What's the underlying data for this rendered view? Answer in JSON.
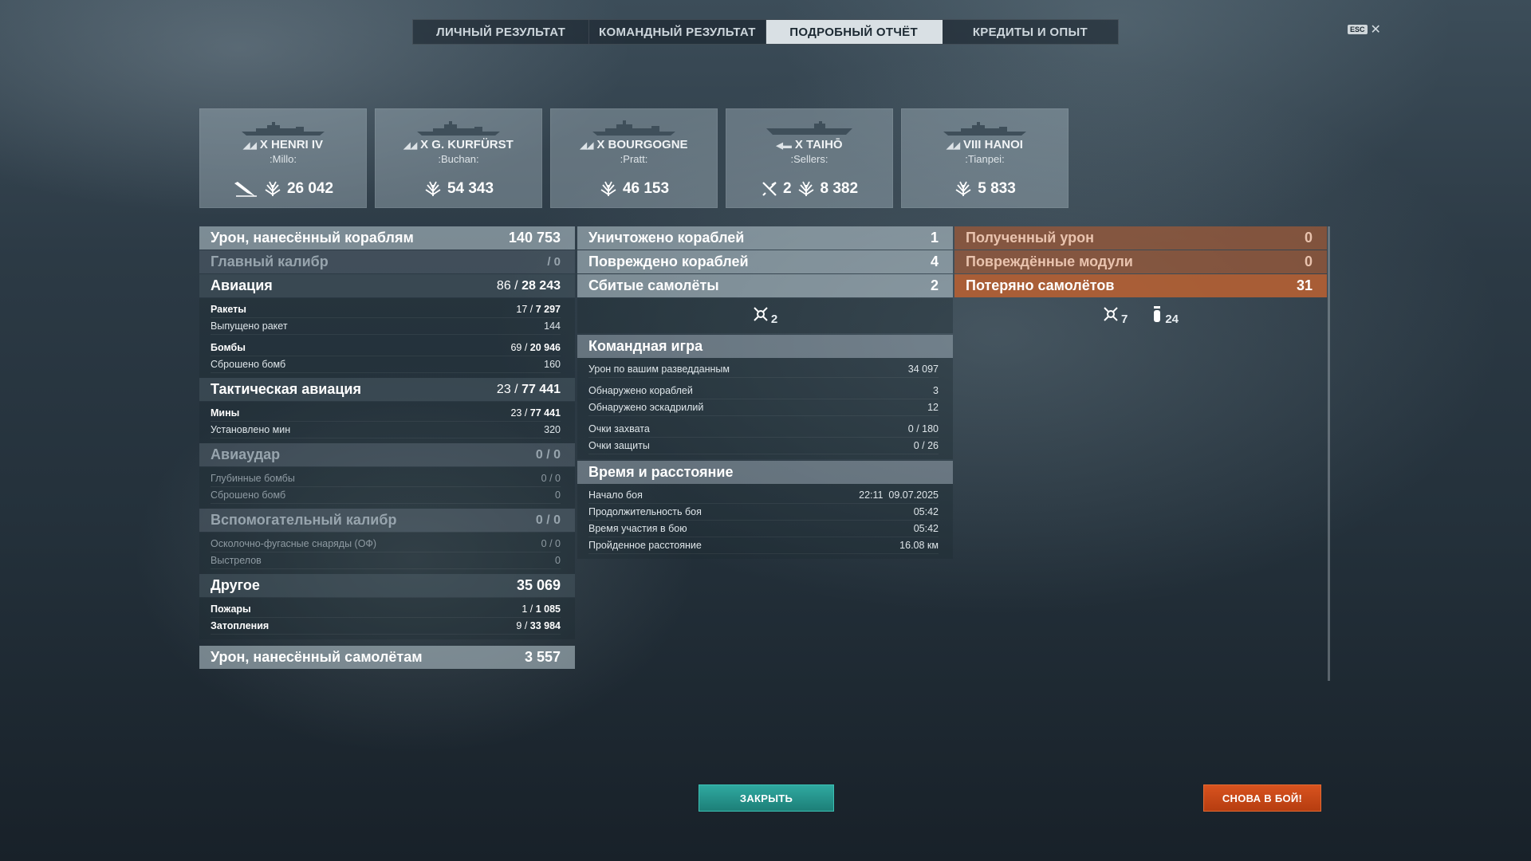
{
  "tabs": [
    "ЛИЧНЫЙ РЕЗУЛЬТАТ",
    "КОМАНДНЫЙ РЕЗУЛЬТАТ",
    "ПОДРОБНЫЙ ОТЧЁТ",
    "КРЕДИТЫ И ОПЫТ"
  ],
  "active_tab": "ПОДРОБНЫЙ ОТЧЁТ",
  "esc": {
    "key": "ESC",
    "close": "✕"
  },
  "ships": [
    {
      "tier": "X",
      "name": "HENRI IV",
      "player": ":Millo:",
      "damage": "26 042",
      "extra": ""
    },
    {
      "tier": "X",
      "name": "G. KURFÜRST",
      "player": ":Buchan:",
      "damage": "54 343",
      "extra": ""
    },
    {
      "tier": "X",
      "name": "BOURGOGNE",
      "player": ":Pratt:",
      "damage": "46 153",
      "extra": ""
    },
    {
      "tier": "X",
      "name": "TAIHŌ",
      "player": ":Sellers:",
      "damage": "8 382",
      "extra": "2"
    },
    {
      "tier": "VIII",
      "name": "HANOI",
      "player": ":Tianpei:",
      "damage": "5 833",
      "extra": ""
    }
  ],
  "col1": {
    "damage_ships": {
      "label": "Урон, нанесённый кораблям",
      "value": "140 753"
    },
    "main_caliber": {
      "label": "Главный калибр",
      "value": "/ 0"
    },
    "aviation": {
      "label": "Авиация",
      "value_a": "86 / ",
      "value_b": "28 243"
    },
    "rockets": {
      "label": "Ракеты",
      "value_a": "17 / ",
      "value_b": "7 297"
    },
    "rockets_fired": {
      "label": "Выпущено ракет",
      "value": "144"
    },
    "bombs": {
      "label": "Бомбы",
      "value_a": "69 / ",
      "value_b": "20 946"
    },
    "bombs_dropped": {
      "label": "Сброшено бомб",
      "value": "160"
    },
    "tactical": {
      "label": "Тактическая авиация",
      "value_a": "23 / ",
      "value_b": "77 441"
    },
    "mines": {
      "label": "Мины",
      "value_a": "23 / ",
      "value_b": "77 441"
    },
    "mines_set": {
      "label": "Установлено мин",
      "value": "320"
    },
    "airstrike": {
      "label": "Авиаудар",
      "value": "0 / 0"
    },
    "depth_charges": {
      "label": "Глубинные бомбы",
      "value": "0 / 0"
    },
    "depth_dropped": {
      "label": "Сброшено бомб",
      "value": "0"
    },
    "secondary": {
      "label": "Вспомогательный калибр",
      "value": "0 / 0"
    },
    "he_shells": {
      "label": "Осколочно-фугасные снаряды (ОФ)",
      "value": "0 / 0"
    },
    "shots": {
      "label": "Выстрелов",
      "value": "0"
    },
    "other": {
      "label": "Другое",
      "value": "35 069"
    },
    "fires": {
      "label": "Пожары",
      "value_a": "1 / ",
      "value_b": "1 085"
    },
    "floods": {
      "label": "Затопления",
      "value_a": "9 / ",
      "value_b": "33 984"
    },
    "damage_planes": {
      "label": "Урон, нанесённый самолётам",
      "value": "3 557"
    }
  },
  "col2": {
    "destroyed": {
      "label": "Уничтожено кораблей",
      "value": "1"
    },
    "damaged": {
      "label": "Повреждено кораблей",
      "value": "4"
    },
    "planes_shot": {
      "label": "Сбитые самолёты",
      "value": "2"
    },
    "planes_icon_count": "2",
    "team_header": "Командная игра",
    "spotting_damage": {
      "label": "Урон по вашим разведданным",
      "value": "34 097"
    },
    "ships_spotted": {
      "label": "Обнаружено кораблей",
      "value": "3"
    },
    "squadrons_spotted": {
      "label": "Обнаружено эскадрилий",
      "value": "12"
    },
    "capture_points": {
      "label": "Очки захвата",
      "value": "0 / 180"
    },
    "defense_points": {
      "label": "Очки защиты",
      "value": "0 / 26"
    },
    "time_header": "Время и расстояние",
    "battle_start": {
      "label": "Начало боя",
      "value": "22:11  09.07.2025"
    },
    "battle_duration": {
      "label": "Продолжительность боя",
      "value": "05:42"
    },
    "time_in_battle": {
      "label": "Время участия в бою",
      "value": "05:42"
    },
    "distance": {
      "label": "Пройденное расстояние",
      "value": "16.08 км"
    }
  },
  "col3": {
    "damage_received": {
      "label": "Полученный урон",
      "value": "0"
    },
    "modules_damaged": {
      "label": "Повреждённые модули",
      "value": "0"
    },
    "planes_lost": {
      "label": "Потеряно самолётов",
      "value": "31"
    },
    "lost_shot_down": "7",
    "lost_other": "24"
  },
  "buttons": {
    "close": "ЗАКРЫТЬ",
    "battle": "СНОВА В БОЙ!"
  }
}
